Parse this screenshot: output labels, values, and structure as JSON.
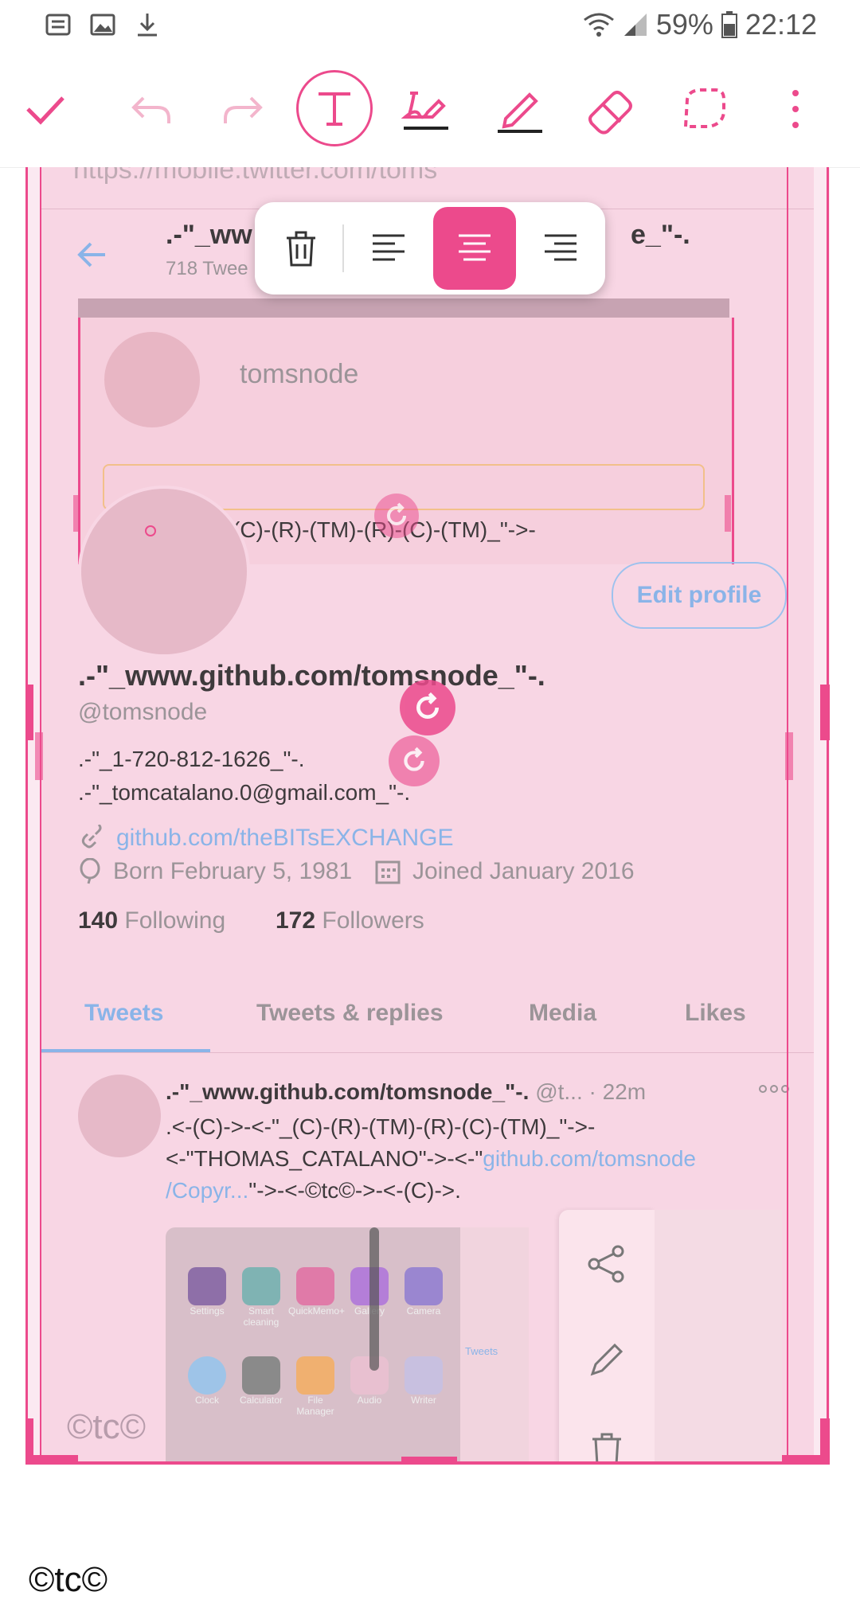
{
  "status_bar": {
    "battery": "59%",
    "time": "22:12"
  },
  "toolbar": {
    "tools": [
      "done-check-icon",
      "undo-icon",
      "redo-icon",
      "text-tool-icon",
      "handwriting-icon",
      "pencil-icon",
      "eraser-icon",
      "lasso-icon",
      "more-vert-icon"
    ],
    "accent": "#ec4a8c"
  },
  "align_popup": {
    "options": [
      "delete-icon",
      "align-left-icon",
      "align-center-icon",
      "align-right-icon"
    ],
    "active": "align-center-icon"
  },
  "profile": {
    "url_partial": "https://mobile.twitter.com/toms",
    "header_name_left": ".-\"_ww",
    "header_name_right": "e_\"-.",
    "header_tweets": "718 Twee",
    "embedded_user": "tomsnode",
    "embedded_text": "(C)-(R)-(TM)-(R)-(C)-(TM)_\"->-",
    "edit_profile": "Edit profile",
    "display_name": ".-\"_www.github.com/tomsnode_\"-.",
    "handle": "@tomsnode",
    "bio_line1": ".-\"_1-720-812-1626_\"-.",
    "bio_line2": ".-\"_tomcatalano.0@gmail.com_\"-.",
    "link": "github.com/theBITsEXCHANGE",
    "born": "Born February 5, 1981",
    "joined": "Joined January 2016",
    "following_count": "140",
    "following_label": "Following",
    "followers_count": "172",
    "followers_label": "Followers",
    "tabs": [
      "Tweets",
      "Tweets & replies",
      "Media",
      "Likes"
    ]
  },
  "tweet": {
    "name": ".-\"_www.github.com/tomsnode_\"-.",
    "handle": "@t...",
    "time": "· 22m",
    "line1": ".<-(C)->-<-\"_(C)-(R)-(TM)-(R)-(C)-(TM)_\"->-",
    "line2_a": "<-\"THOMAS_CATALANO\"->-<-\"",
    "line2_link": "github.com/tomsnode",
    "line3_link": "/Copyr...",
    "line3_b": "\"->-<-©tc©->-<-(C)->.",
    "apps": [
      "Settings",
      "Smart cleaning",
      "QuickMemo+",
      "Gallery",
      "Camera",
      "Clock",
      "Calculator",
      "File Manager",
      "Audio",
      "Writer"
    ],
    "mini_tweets": "Tweets"
  },
  "watermark_inner": "©tc©",
  "watermark_bottom": "©tc©"
}
